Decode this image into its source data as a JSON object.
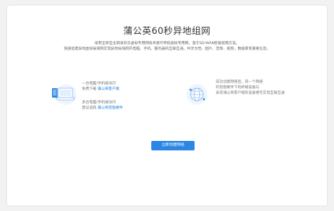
{
  "page": {
    "title": "蒲公英60秒异地组网",
    "description_line1": "采用全新自主研发的云虚拟专用网技术替代传统虚拟专用网，基于SD-WAN智能组网方案，",
    "description_line2": "快速组建异地虚拟局域网实现异地局域网内电脑、手机、服务器的互联互通，共享文档、图片、音频、视频，数据库等重要信息。"
  },
  "features": [
    {
      "line1": "一台电脑/手机被访问",
      "line2_prefix": "免费下载 ",
      "line2_link": "蒲公英客户端"
    },
    {
      "line1": "多台电脑/手机被访问",
      "line2_prefix": "建议选购 ",
      "line2_link": "蒲公英智能硬件"
    },
    {
      "line1": "成功创建网络后，同一个网络",
      "line2": "的智能硬件下的终端设备与",
      "line3": "安装蒲公英客户端的设备便可实现互联互通"
    }
  ],
  "cta": {
    "label": "立即创建网络"
  },
  "colors": {
    "accent": "#2b86e4",
    "link": "#1f7de0"
  }
}
